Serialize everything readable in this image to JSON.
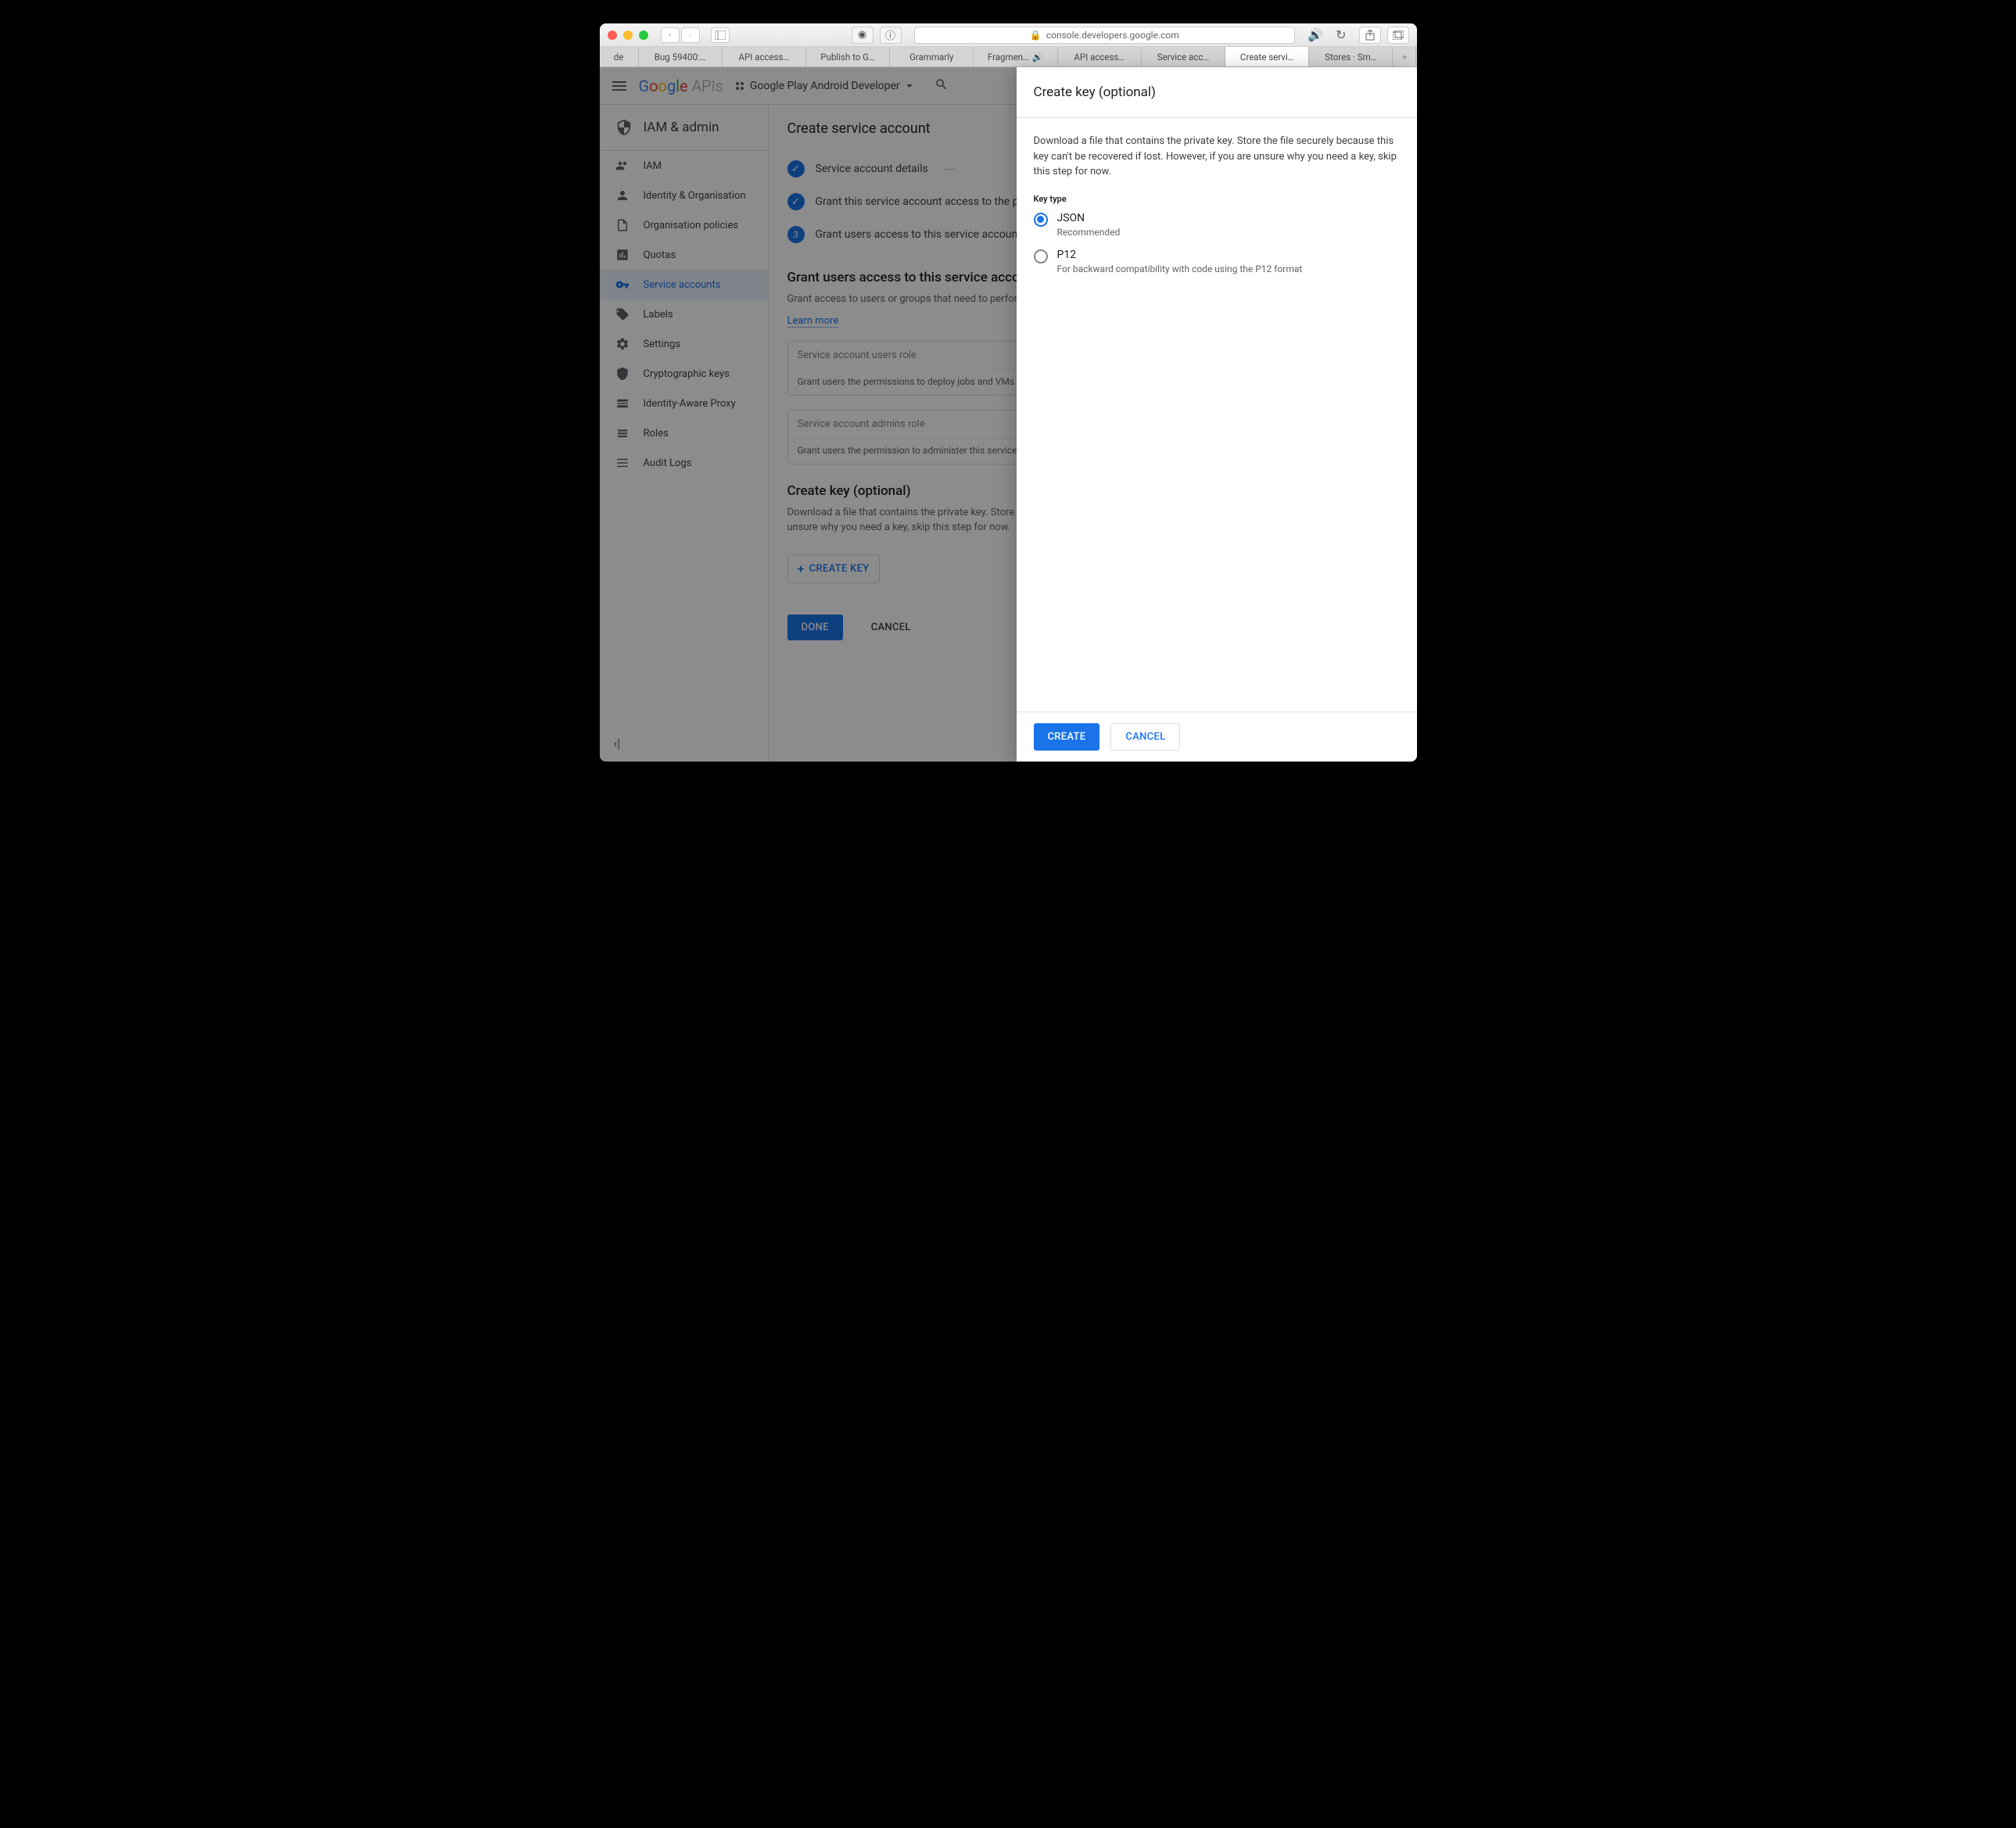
{
  "browser": {
    "url": "console.developers.google.com",
    "tabs": [
      "de",
      "Bug 59400:…",
      "API access…",
      "Publish to G…",
      "Grammarly",
      "Fragmen…",
      "API access…",
      "Service acc…",
      "Create servi…",
      "Stores · Sm…"
    ]
  },
  "appbar": {
    "logo_text": "Google",
    "logo_suffix": "APIs",
    "project": "Google Play Android Developer"
  },
  "sidebar": {
    "title": "IAM & admin",
    "items": [
      {
        "label": "IAM",
        "icon": "people"
      },
      {
        "label": "Identity & Organisation",
        "icon": "person"
      },
      {
        "label": "Organisation policies",
        "icon": "doc"
      },
      {
        "label": "Quotas",
        "icon": "meter"
      },
      {
        "label": "Service accounts",
        "icon": "key"
      },
      {
        "label": "Labels",
        "icon": "tag"
      },
      {
        "label": "Settings",
        "icon": "gear"
      },
      {
        "label": "Cryptographic keys",
        "icon": "shield"
      },
      {
        "label": "Identity-Aware Proxy",
        "icon": "proxy"
      },
      {
        "label": "Roles",
        "icon": "roles"
      },
      {
        "label": "Audit Logs",
        "icon": "logs"
      }
    ]
  },
  "main": {
    "title": "Create service account",
    "steps": [
      {
        "label": "Service account details",
        "done": true,
        "trail": true
      },
      {
        "label": "Grant this service account access to the project (optional)",
        "done": true
      },
      {
        "label": "Grant users access to this service account (optional)",
        "done": false,
        "num": "3"
      }
    ],
    "grant": {
      "title": "Grant users access to this service account (optional)",
      "desc": "Grant access to users or groups that need to perform actions as this service account.",
      "learn": "Learn more",
      "field1_label": "Service account users role",
      "field1_help": "Grant users the permissions to deploy jobs and VMs with this service account",
      "field2_label": "Service account admins role",
      "field2_help": "Grant users the permission to administer this service account"
    },
    "createkey": {
      "title": "Create key (optional)",
      "desc": "Download a file that contains the private key. Store the file securely because this key can't be recovered if lost. However, if you are unsure why you need a key, skip this step for now.",
      "button": "CREATE KEY"
    },
    "done_btn": "DONE",
    "cancel_btn": "CANCEL"
  },
  "panel": {
    "title": "Create key (optional)",
    "desc": "Download a file that contains the private key. Store the file securely because this key can't be recovered if lost. However, if you are unsure why you need a key, skip this step for now.",
    "keytype_label": "Key type",
    "opt1": {
      "label": "JSON",
      "sub": "Recommended"
    },
    "opt2": {
      "label": "P12",
      "sub": "For backward compatibility with code using the P12 format"
    },
    "create_btn": "CREATE",
    "cancel_btn": "CANCEL"
  }
}
